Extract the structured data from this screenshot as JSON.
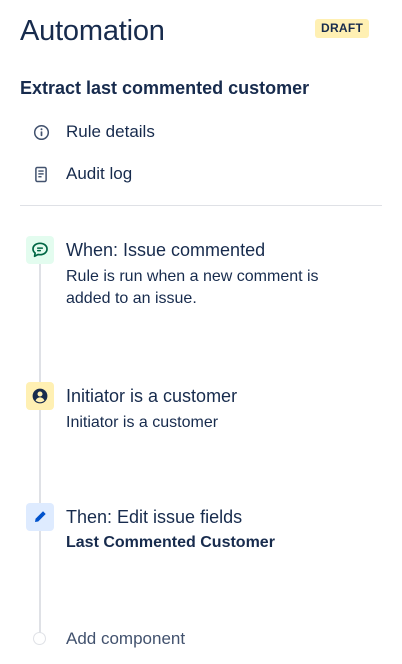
{
  "header": {
    "title": "Automation",
    "status_badge": "DRAFT"
  },
  "rule": {
    "name": "Extract last commented customer"
  },
  "nav": {
    "items": [
      {
        "label": "Rule details",
        "icon": "info-icon"
      },
      {
        "label": "Audit log",
        "icon": "document-icon"
      }
    ]
  },
  "steps": [
    {
      "kind": "trigger",
      "icon": "comment-icon",
      "title": "When: Issue commented",
      "description": "Rule is run when a new comment is added to an issue.",
      "icon_bg": "#e3fcef",
      "icon_color": "#006644"
    },
    {
      "kind": "condition",
      "icon": "user-circle-icon",
      "title": "Initiator is a customer",
      "description": "Initiator is a customer",
      "icon_bg": "#fff0b3",
      "icon_color": "#172b4d"
    },
    {
      "kind": "action",
      "icon": "pencil-icon",
      "title": "Then: Edit issue fields",
      "description": "Last Commented Customer",
      "icon_bg": "#deebff",
      "icon_color": "#0052cc"
    }
  ],
  "add_component": {
    "label": "Add component"
  },
  "colors": {
    "text": "#172b4d",
    "subtle_text": "#42526e",
    "badge_bg": "#fff0b3",
    "divider": "#dfe1e6"
  }
}
